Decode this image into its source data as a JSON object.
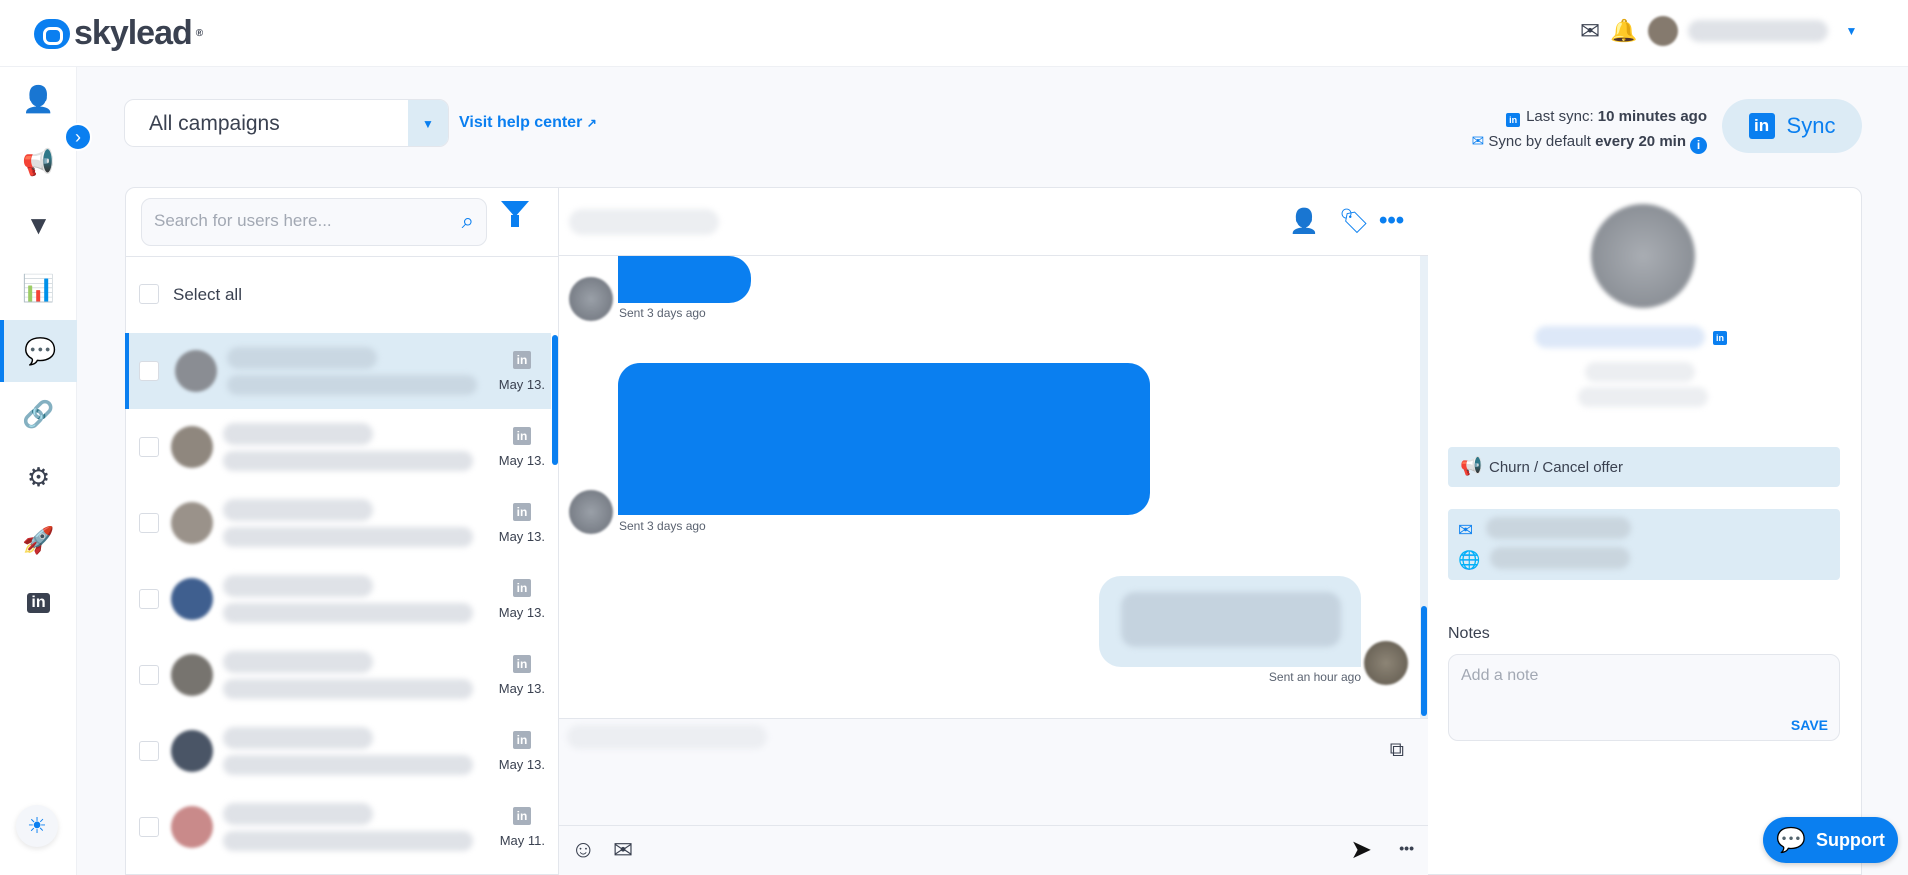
{
  "brand": {
    "name": "skylead",
    "accent": "#0a7ff0"
  },
  "header": {
    "icons": [
      "mail-send-icon",
      "bell-icon",
      "avatar",
      "chevron-down-icon"
    ]
  },
  "sidebar": {
    "items": [
      {
        "icon": "user-icon",
        "glyph": "👤"
      },
      {
        "icon": "megaphone-icon",
        "glyph": "📢"
      },
      {
        "icon": "filter-icon",
        "glyph": "▼"
      },
      {
        "icon": "chart-icon",
        "glyph": "📊"
      },
      {
        "icon": "chat-icon",
        "glyph": "💬",
        "active": true
      },
      {
        "icon": "link-icon",
        "glyph": "🔗"
      },
      {
        "icon": "gear-icon",
        "glyph": "⚙"
      },
      {
        "icon": "rocket-icon",
        "glyph": "🚀"
      },
      {
        "icon": "linkedin-icon",
        "glyph": "in"
      }
    ]
  },
  "toolbar": {
    "campaign_select": "All campaigns",
    "help_link": "Visit help center",
    "last_sync_label": "Last sync:",
    "last_sync_value": "10 minutes ago",
    "sync_default_label": "Sync by default",
    "sync_default_value": "every 20 min",
    "sync_button": "Sync"
  },
  "list": {
    "search_placeholder": "Search for users here...",
    "select_all": "Select all",
    "items": [
      {
        "date": "May 13.",
        "selected": true,
        "avatar": "#8a8d93"
      },
      {
        "date": "May 13.",
        "avatar": "#8f877e"
      },
      {
        "date": "May 13.",
        "avatar": "#9a928a"
      },
      {
        "date": "May 13.",
        "avatar": "#3f5f8f"
      },
      {
        "date": "May 13.",
        "avatar": "#77746f"
      },
      {
        "date": "May 13.",
        "avatar": "#4a5566"
      },
      {
        "date": "May 11.",
        "avatar": "#c98a8a"
      }
    ]
  },
  "chat": {
    "messages": [
      {
        "direction": "incoming",
        "time": "Sent 3 days ago"
      },
      {
        "direction": "incoming",
        "time": "Sent 3 days ago"
      },
      {
        "direction": "outgoing",
        "time": "Sent an hour ago"
      }
    ]
  },
  "profile": {
    "campaign": "Churn / Cancel offer",
    "notes_label": "Notes",
    "notes_placeholder": "Add a note",
    "save": "SAVE"
  },
  "support": "Support"
}
